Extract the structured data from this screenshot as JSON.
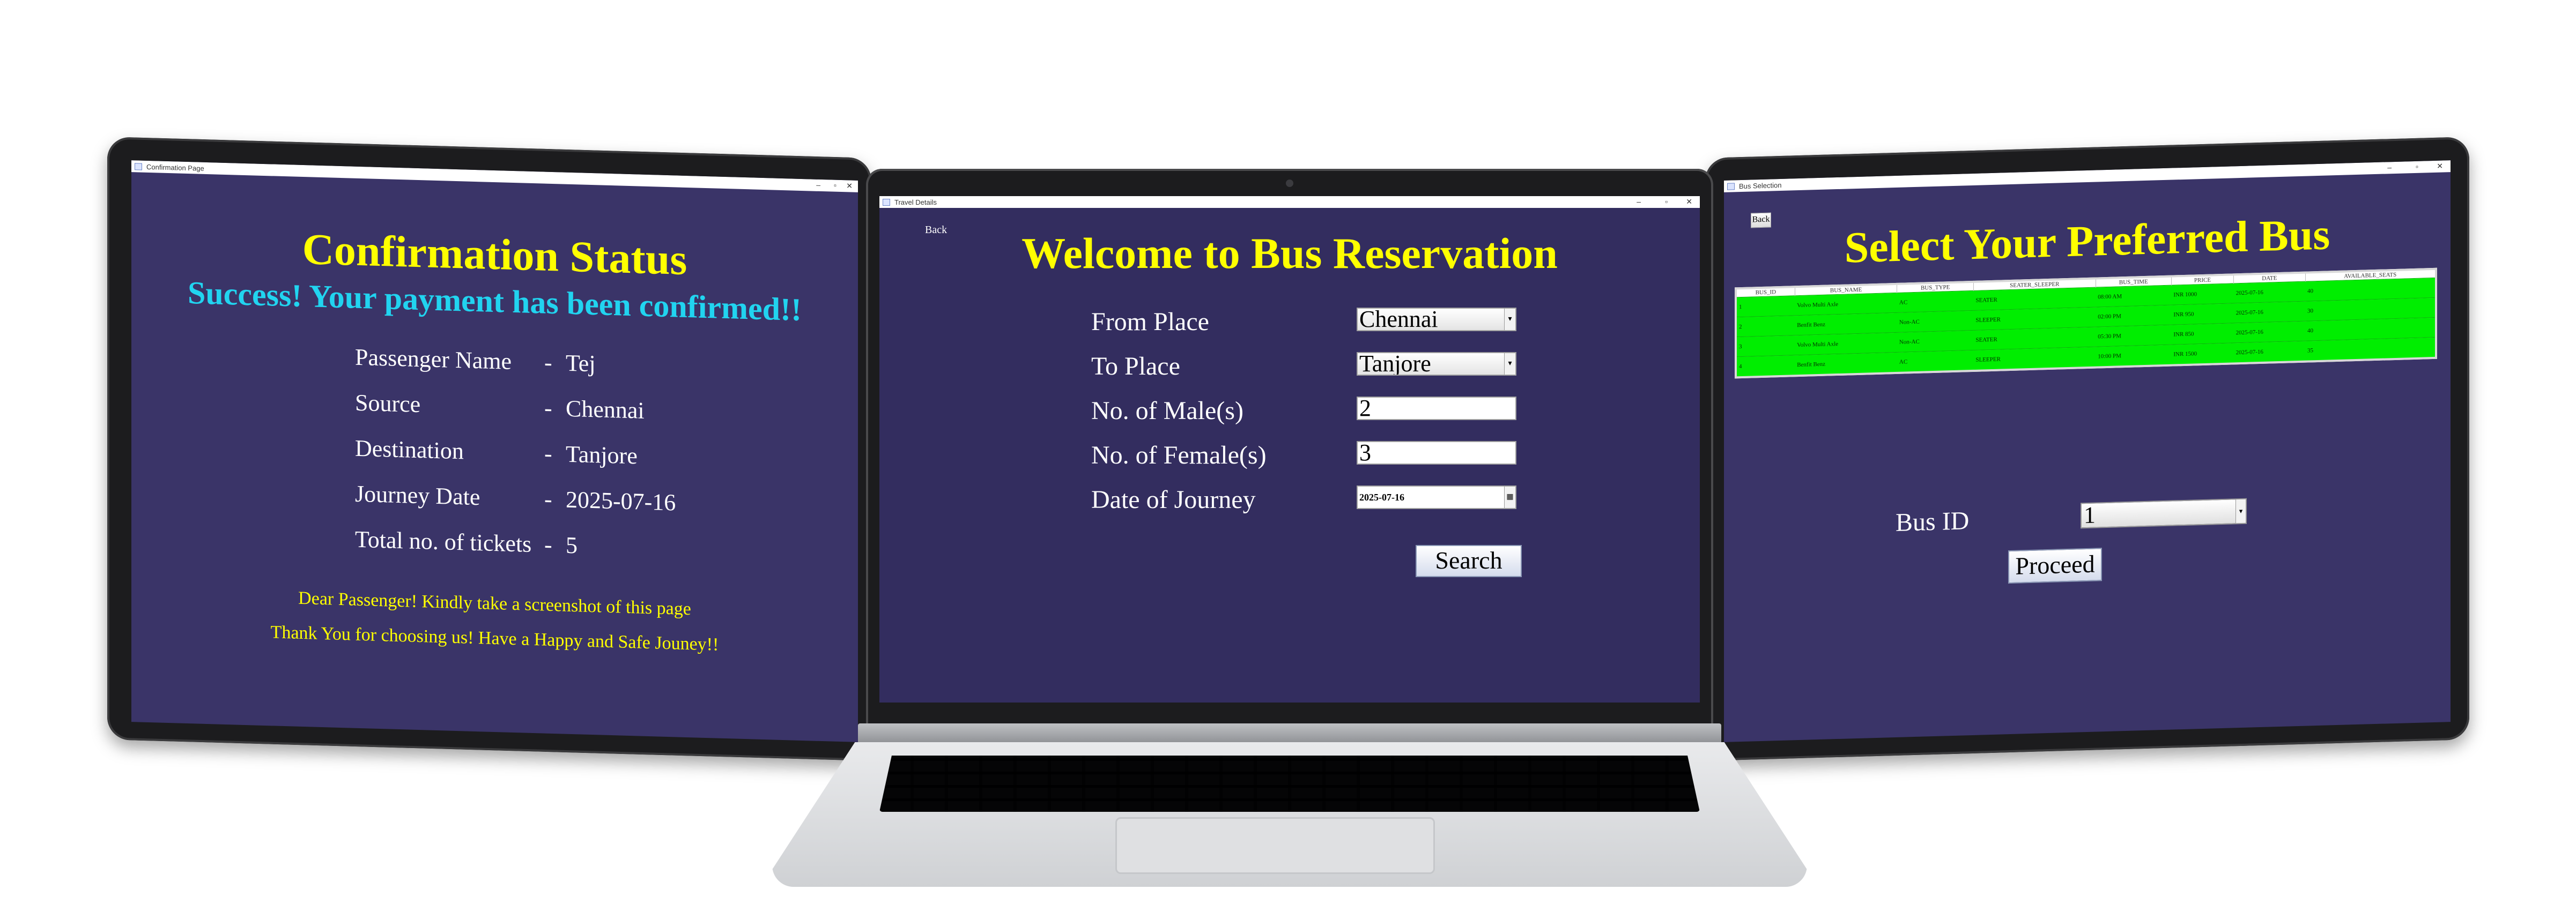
{
  "confirmation": {
    "window_title": "Confirmation Page",
    "heading": "Confirmation Status",
    "success_message": "Success! Your payment has been confirmed!!",
    "fields": [
      {
        "label": "Passenger Name",
        "sep": "-",
        "value": "Tej"
      },
      {
        "label": "Source",
        "sep": "-",
        "value": "Chennai"
      },
      {
        "label": "Destination",
        "sep": "-",
        "value": "Tanjore"
      },
      {
        "label": "Journey Date",
        "sep": "-",
        "value": "2025-07-16"
      },
      {
        "label": "Total no. of tickets",
        "sep": "-",
        "value": "5"
      }
    ],
    "note_1": "Dear Passenger! Kindly take a screenshot of this page",
    "note_2": "Thank You for choosing us! Have a Happy and Safe Jouney!!"
  },
  "search": {
    "window_title": "Travel Details",
    "back_label": "Back",
    "heading": "Welcome to Bus Reservation",
    "from_label": "From Place",
    "from_value": "Chennai",
    "to_label": "To Place",
    "to_value": "Tanjore",
    "male_label": "No. of Male(s)",
    "male_value": "2",
    "female_label": "No. of Female(s)",
    "female_value": "3",
    "date_label": "Date of Journey",
    "date_value": "2025-07-16",
    "search_button": "Search"
  },
  "bus_selection": {
    "window_title": "Bus Selection",
    "back_label": "Back",
    "heading": "Select Your Preferred Bus",
    "columns": [
      "BUS_ID",
      "BUS_NAME",
      "BUS_TYPE",
      "SEATER_SLEEPER",
      "BUS_TIME",
      "PRICE",
      "DATE",
      "AVAILABLE_SEATS"
    ],
    "rows": [
      [
        "1",
        "Volvo Multi Axle",
        "AC",
        "SEATER",
        "08:00 AM",
        "INR 1000",
        "2025-07-16",
        "40"
      ],
      [
        "2",
        "Benfit Benz",
        "Non-AC",
        "SLEEPER",
        "02:00 PM",
        "INR 950",
        "2025-07-16",
        "30"
      ],
      [
        "3",
        "Volvo Multi Axle",
        "Non-AC",
        "SEATER",
        "05:30 PM",
        "INR 850",
        "2025-07-16",
        "40"
      ],
      [
        "4",
        "Benfit Benz",
        "AC",
        "SLEEPER",
        "10:00 PM",
        "INR 1500",
        "2025-07-16",
        "35"
      ]
    ],
    "bus_id_label": "Bus ID",
    "bus_id_value": "1",
    "proceed_button": "Proceed"
  },
  "window_controls": {
    "minimize": "–",
    "maximize": "▫",
    "close": "✕"
  }
}
